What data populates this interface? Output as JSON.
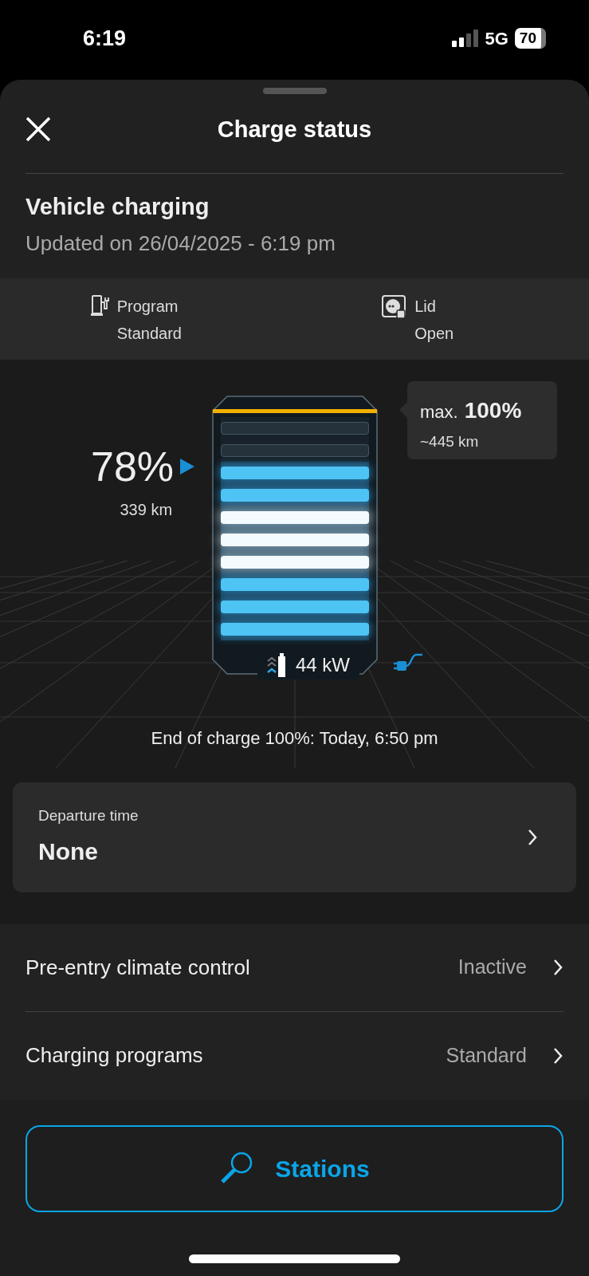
{
  "status_bar": {
    "time": "6:19",
    "network": "5G",
    "battery": "70"
  },
  "header": {
    "title": "Charge status"
  },
  "summary": {
    "title": "Vehicle charging",
    "updated": "Updated on 26/04/2025 - 6:19 pm"
  },
  "info": [
    {
      "kind": "program",
      "label": "Program",
      "value": "Standard"
    },
    {
      "kind": "lid",
      "label": "Lid",
      "value": "Open"
    }
  ],
  "battery": {
    "level": 0.8,
    "percent": "78%",
    "range": "339 km",
    "power": "44 kW",
    "plugged": true,
    "max_label": "max.",
    "max_percent": "100%",
    "max_range": "~445 km",
    "end_of_charge": "End of charge 100%: Today, 6:50 pm"
  },
  "departure": {
    "label": "Departure time",
    "value": "None"
  },
  "settings": [
    {
      "label": "Pre-entry climate control",
      "value": "Inactive"
    },
    {
      "label": "Charging programs",
      "value": "Standard"
    }
  ],
  "action": {
    "label": "Stations"
  }
}
